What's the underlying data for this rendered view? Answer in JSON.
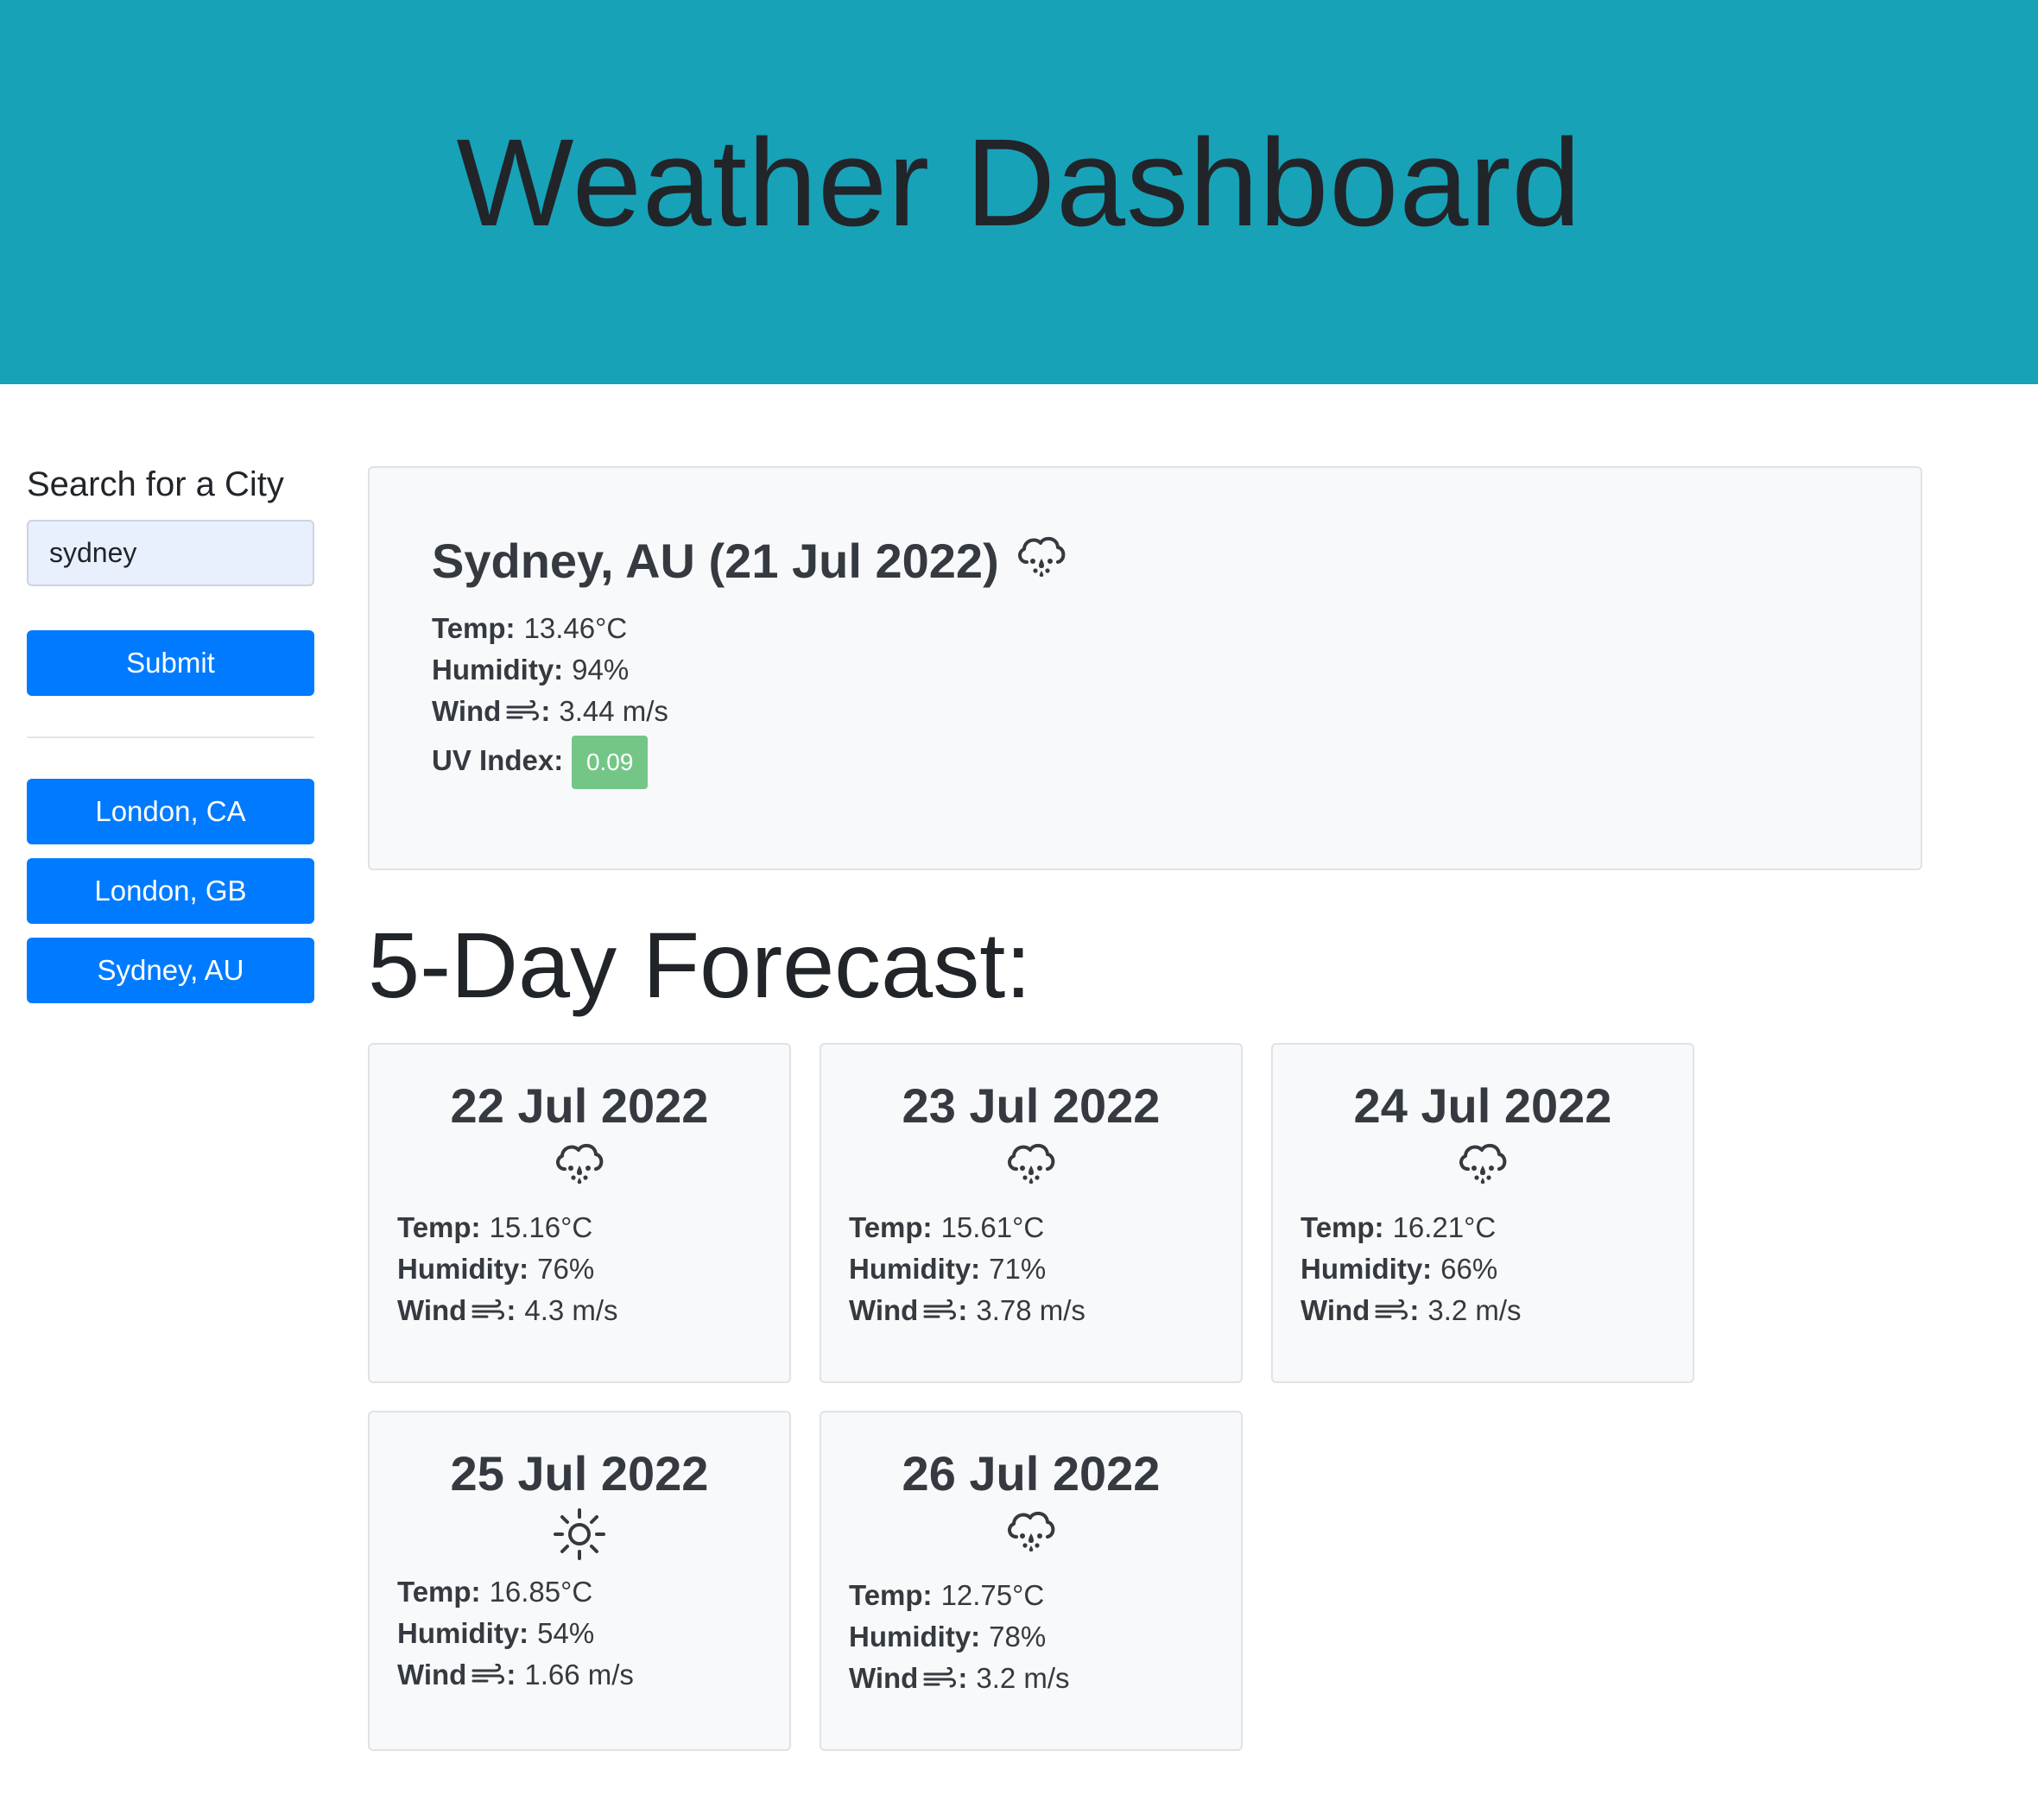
{
  "header": {
    "title": "Weather Dashboard"
  },
  "sidebar": {
    "search_label": "Search for a City",
    "search_value": "sydney",
    "submit_label": "Submit",
    "history": [
      {
        "label": "London, CA"
      },
      {
        "label": "London, GB"
      },
      {
        "label": "Sydney, AU"
      }
    ]
  },
  "current": {
    "title": "Sydney, AU (21 Jul 2022)",
    "icon": "cloud-rain-icon",
    "temp_label": "Temp:",
    "temp": "13.46°C",
    "humidity_label": "Humidity:",
    "humidity": "94%",
    "wind_label": "Wind",
    "wind_suffix": ":",
    "wind": "3.44 m/s",
    "uv_label": "UV Index:",
    "uv": "0.09",
    "uv_color": "#74c687"
  },
  "forecast": {
    "heading": "5-Day Forecast:",
    "days": [
      {
        "date": "22 Jul 2022",
        "icon": "cloud-rain-icon",
        "temp": "15.16°C",
        "humidity": "76%",
        "wind": "4.3 m/s"
      },
      {
        "date": "23 Jul 2022",
        "icon": "cloud-rain-icon",
        "temp": "15.61°C",
        "humidity": "71%",
        "wind": "3.78 m/s"
      },
      {
        "date": "24 Jul 2022",
        "icon": "cloud-rain-icon",
        "temp": "16.21°C",
        "humidity": "66%",
        "wind": "3.2 m/s"
      },
      {
        "date": "25 Jul 2022",
        "icon": "sun-icon",
        "temp": "16.85°C",
        "humidity": "54%",
        "wind": "1.66 m/s"
      },
      {
        "date": "26 Jul 2022",
        "icon": "cloud-rain-icon",
        "temp": "12.75°C",
        "humidity": "78%",
        "wind": "3.2 m/s"
      }
    ],
    "temp_label": "Temp:",
    "humidity_label": "Humidity:",
    "wind_label": "Wind",
    "wind_suffix": ":"
  },
  "colors": {
    "header_bg": "#17a2b8",
    "primary": "#007bff",
    "card_bg": "#f8f9fa"
  }
}
